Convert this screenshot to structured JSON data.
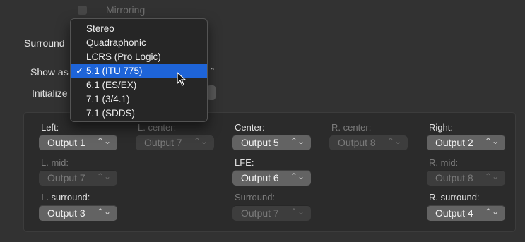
{
  "mirroring": {
    "label": "Mirroring"
  },
  "surround": {
    "section_title": "Surround",
    "show_as_label": "Show as",
    "initialize_label": "Initialize"
  },
  "menu": {
    "items": [
      {
        "label": "Stereo",
        "selected": false
      },
      {
        "label": "Quadraphonic",
        "selected": false
      },
      {
        "label": "LCRS (Pro Logic)",
        "selected": false
      },
      {
        "label": "5.1 (ITU 775)",
        "selected": true
      },
      {
        "label": "6.1 (ES/EX)",
        "selected": false
      },
      {
        "label": "7.1 (3/4.1)",
        "selected": false
      },
      {
        "label": "7.1 (SDDS)",
        "selected": false
      }
    ],
    "checkmark": "✓",
    "highlight_color": "#1e64d8"
  },
  "channels": {
    "left": {
      "label": "Left:",
      "value": "Output 1",
      "enabled": true
    },
    "l_center": {
      "label": "L. center:",
      "value": "Output 7",
      "enabled": false
    },
    "center": {
      "label": "Center:",
      "value": "Output 5",
      "enabled": true
    },
    "r_center": {
      "label": "R. center:",
      "value": "Output 8",
      "enabled": false
    },
    "right": {
      "label": "Right:",
      "value": "Output 2",
      "enabled": true
    },
    "l_mid": {
      "label": "L. mid:",
      "value": "Output 7",
      "enabled": false
    },
    "lfe": {
      "label": "LFE:",
      "value": "Output 6",
      "enabled": true
    },
    "r_mid": {
      "label": "R. mid:",
      "value": "Output 8",
      "enabled": false
    },
    "l_surround": {
      "label": "L. surround:",
      "value": "Output 3",
      "enabled": true
    },
    "surround": {
      "label": "Surround:",
      "value": "Output 7",
      "enabled": false
    },
    "r_surround": {
      "label": "R. surround:",
      "value": "Output 4",
      "enabled": true
    }
  },
  "icons": {
    "popup_arrows": "chevron-updown-icon",
    "cursor": "mouse-pointer-icon"
  }
}
